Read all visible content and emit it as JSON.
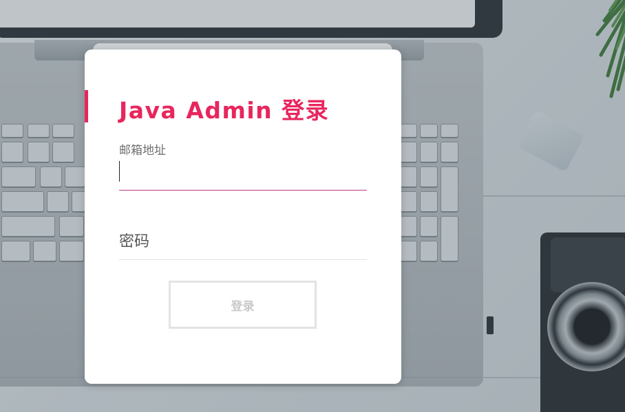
{
  "login": {
    "title": "Java Admin 登录",
    "email_label": "邮箱地址",
    "email_value": "",
    "password_placeholder": "密码",
    "password_value": "",
    "submit_label": "登录"
  },
  "colors": {
    "accent": "#e8265d",
    "focus_underline": "#b8368c",
    "button_border": "#e3e3e3",
    "button_text": "#c9c9c9"
  },
  "icons": [
    "keyboard-decor",
    "camera-decor",
    "plant-decor"
  ]
}
